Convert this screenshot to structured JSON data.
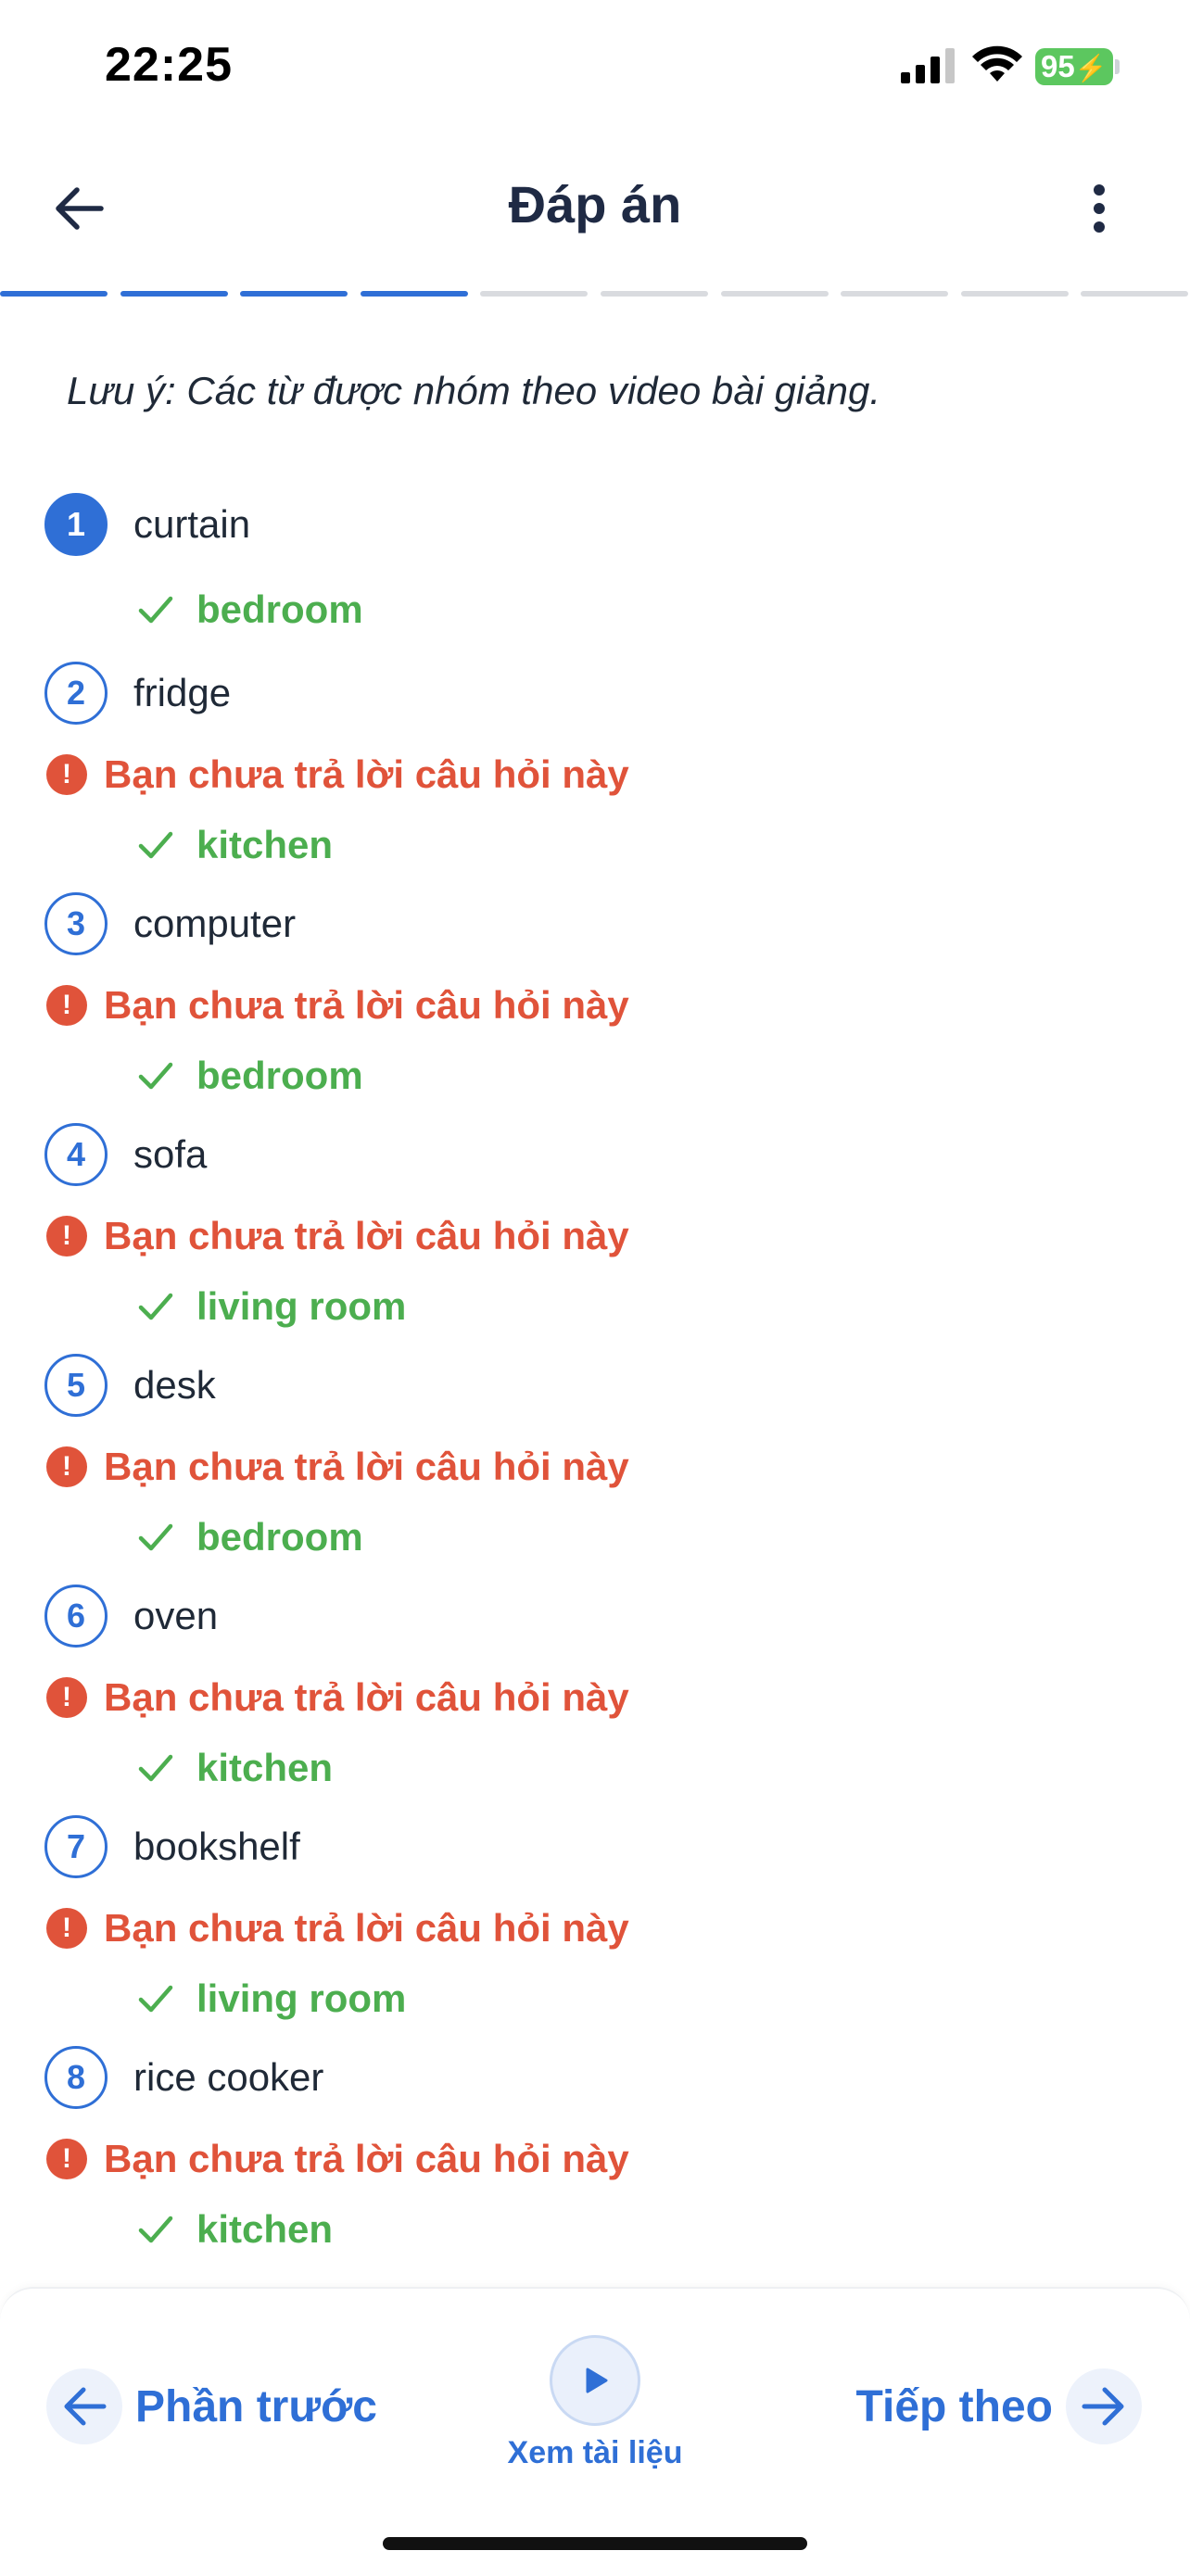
{
  "status_bar": {
    "time": "22:25",
    "battery": "95"
  },
  "header": {
    "title": "Đáp án"
  },
  "progress": {
    "total_segments": 10,
    "completed_segments": 4
  },
  "note": "Lưu ý: Các từ được nhóm theo video bài giảng.",
  "warning_text": "Bạn chưa trả lời câu hỏi này",
  "questions": [
    {
      "num": "1",
      "word": "curtain",
      "answer": "bedroom",
      "unanswered": false
    },
    {
      "num": "2",
      "word": "fridge",
      "answer": "kitchen",
      "unanswered": true
    },
    {
      "num": "3",
      "word": "computer",
      "answer": "bedroom",
      "unanswered": true
    },
    {
      "num": "4",
      "word": "sofa",
      "answer": "living room",
      "unanswered": true
    },
    {
      "num": "5",
      "word": "desk",
      "answer": "bedroom",
      "unanswered": true
    },
    {
      "num": "6",
      "word": "oven",
      "answer": "kitchen",
      "unanswered": true
    },
    {
      "num": "7",
      "word": "bookshelf",
      "answer": "living room",
      "unanswered": true
    },
    {
      "num": "8",
      "word": "rice cooker",
      "answer": "kitchen",
      "unanswered": true
    }
  ],
  "bottom": {
    "prev_label": "Phần trước",
    "doc_label": "Xem tài liệu",
    "next_label": "Tiếp theo"
  },
  "colors": {
    "accent": "#2f6fd6",
    "error": "#e0533a",
    "success": "#4cae4f"
  }
}
